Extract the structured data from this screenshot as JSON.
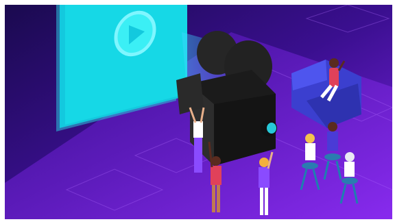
{
  "illustration": {
    "subject": "film-production-scene",
    "elements": [
      "projection-screen",
      "play-icon",
      "film-camera",
      "crew-members",
      "sofa",
      "seated-audience"
    ],
    "colors": {
      "background_dark": "#2a0c6e",
      "background_floor": "#6d1fd6",
      "screen_cyan": "#16d8e6",
      "camera_black": "#1b1b1b",
      "sofa_blue": "#3b3fcf",
      "shirt_red": "#e0415a",
      "pants_purple": "#8a4bff",
      "light_beam": "#3ed9ff"
    }
  }
}
